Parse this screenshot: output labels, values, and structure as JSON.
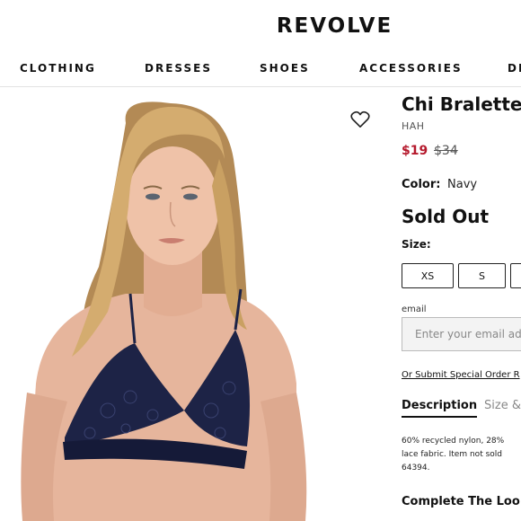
{
  "header": {
    "logo": "REVOLVE"
  },
  "nav": {
    "items": [
      "CLOTHING",
      "DRESSES",
      "SHOES",
      "ACCESSORIES",
      "DE"
    ]
  },
  "product": {
    "title": "Chi Bralette",
    "brand": "HAH",
    "price_sale": "$19",
    "price_original": "$34",
    "color_label": "Color:",
    "color_value": "Navy",
    "stock_status": "Sold Out",
    "size_label": "Size:",
    "sizes": [
      "XS",
      "S",
      ""
    ]
  },
  "notify": {
    "email_label": "email",
    "email_placeholder": "Enter your email ad",
    "special_order_link": "Or Submit Special Order R"
  },
  "tabs": {
    "description": "Description",
    "size": "Size &"
  },
  "description": {
    "line1": "60% recycled nylon, 28%",
    "line2": "lace fabric. Item not sold",
    "line3": "64394."
  },
  "complete_look": "Complete The Loo",
  "colors": {
    "sale_price": "#b5192c",
    "bra": "#1d2346",
    "skin": "#e8b9a0",
    "hair": "#c9a26a"
  },
  "icons": {
    "wishlist": "heart-icon"
  }
}
